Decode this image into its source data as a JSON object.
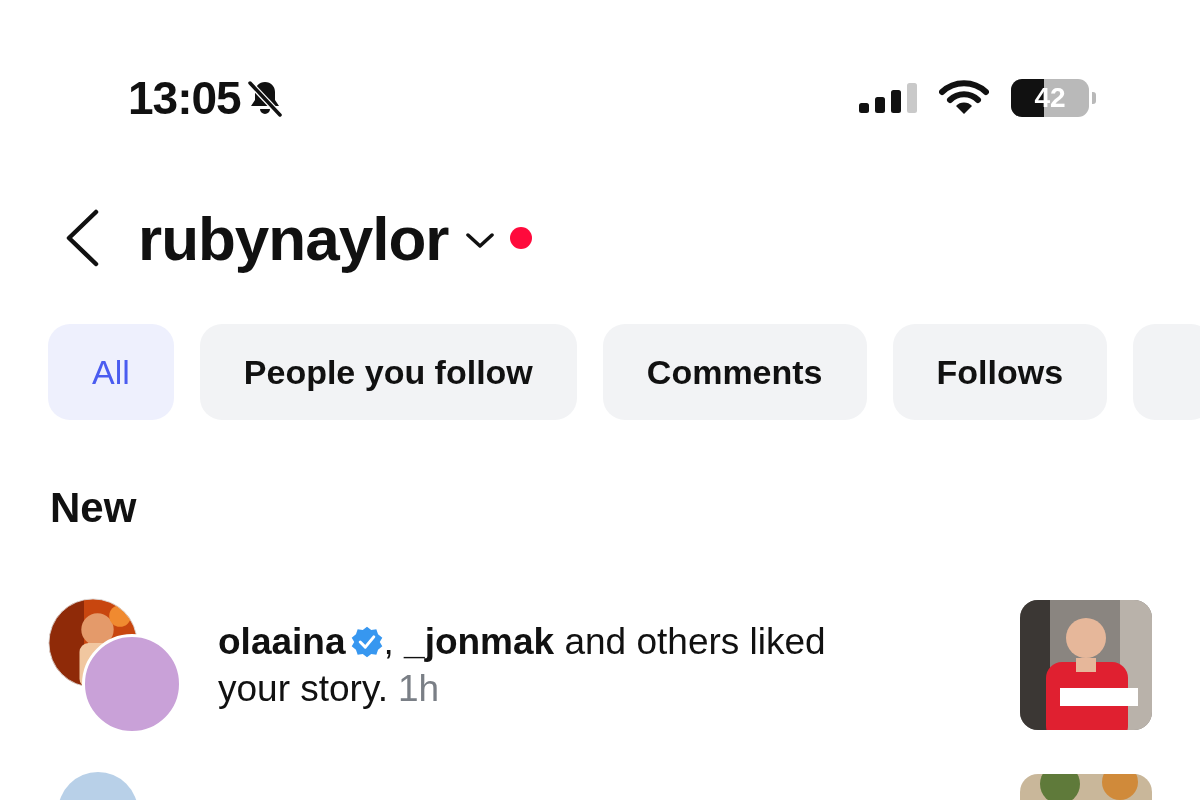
{
  "status_bar": {
    "time": "13:05",
    "silent": true,
    "battery": {
      "text": "42",
      "level": 0.42
    }
  },
  "header": {
    "title": "rubynaylor",
    "has_new": true
  },
  "filters": [
    {
      "label": "All",
      "selected": true
    },
    {
      "label": "People you follow",
      "selected": false
    },
    {
      "label": "Comments",
      "selected": false
    },
    {
      "label": "Follows",
      "selected": false
    }
  ],
  "section_title": "New",
  "notifications": [
    {
      "actor": "olaaina",
      "actor_verified": true,
      "text": ", **_jonmak** and others liked your story.",
      "time": "1h"
    }
  ]
}
